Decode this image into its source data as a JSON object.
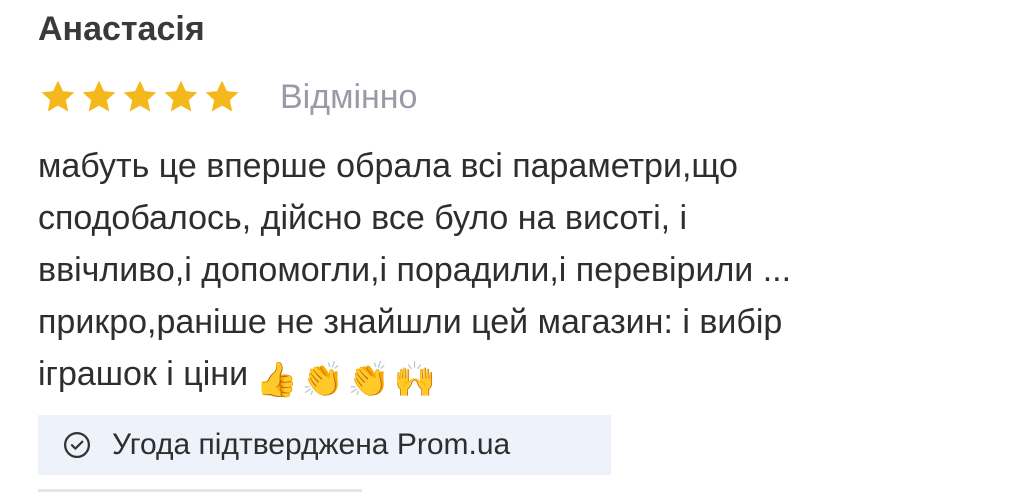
{
  "review": {
    "author": "Анастасія",
    "rating": 5,
    "rating_max": 5,
    "rating_label": "Відмінно",
    "star_color": "#f5b81c",
    "text": "мабуть це вперше обрала всі параметри,що\nсподобалось, дійсно все було на висоті, і\nввічливо,і допомогли,і порадили,і перевірили ...\nприкро,раніше не знайшли цей магазин: і вибір\nіграшок і ціни",
    "emojis": [
      "👍",
      "👏",
      "👏",
      "🙌"
    ],
    "verified_label": "Угода підтверджена Prom.ua"
  },
  "colors": {
    "verified_bg": "#eef2fa",
    "muted_text": "#9a9aa6"
  }
}
